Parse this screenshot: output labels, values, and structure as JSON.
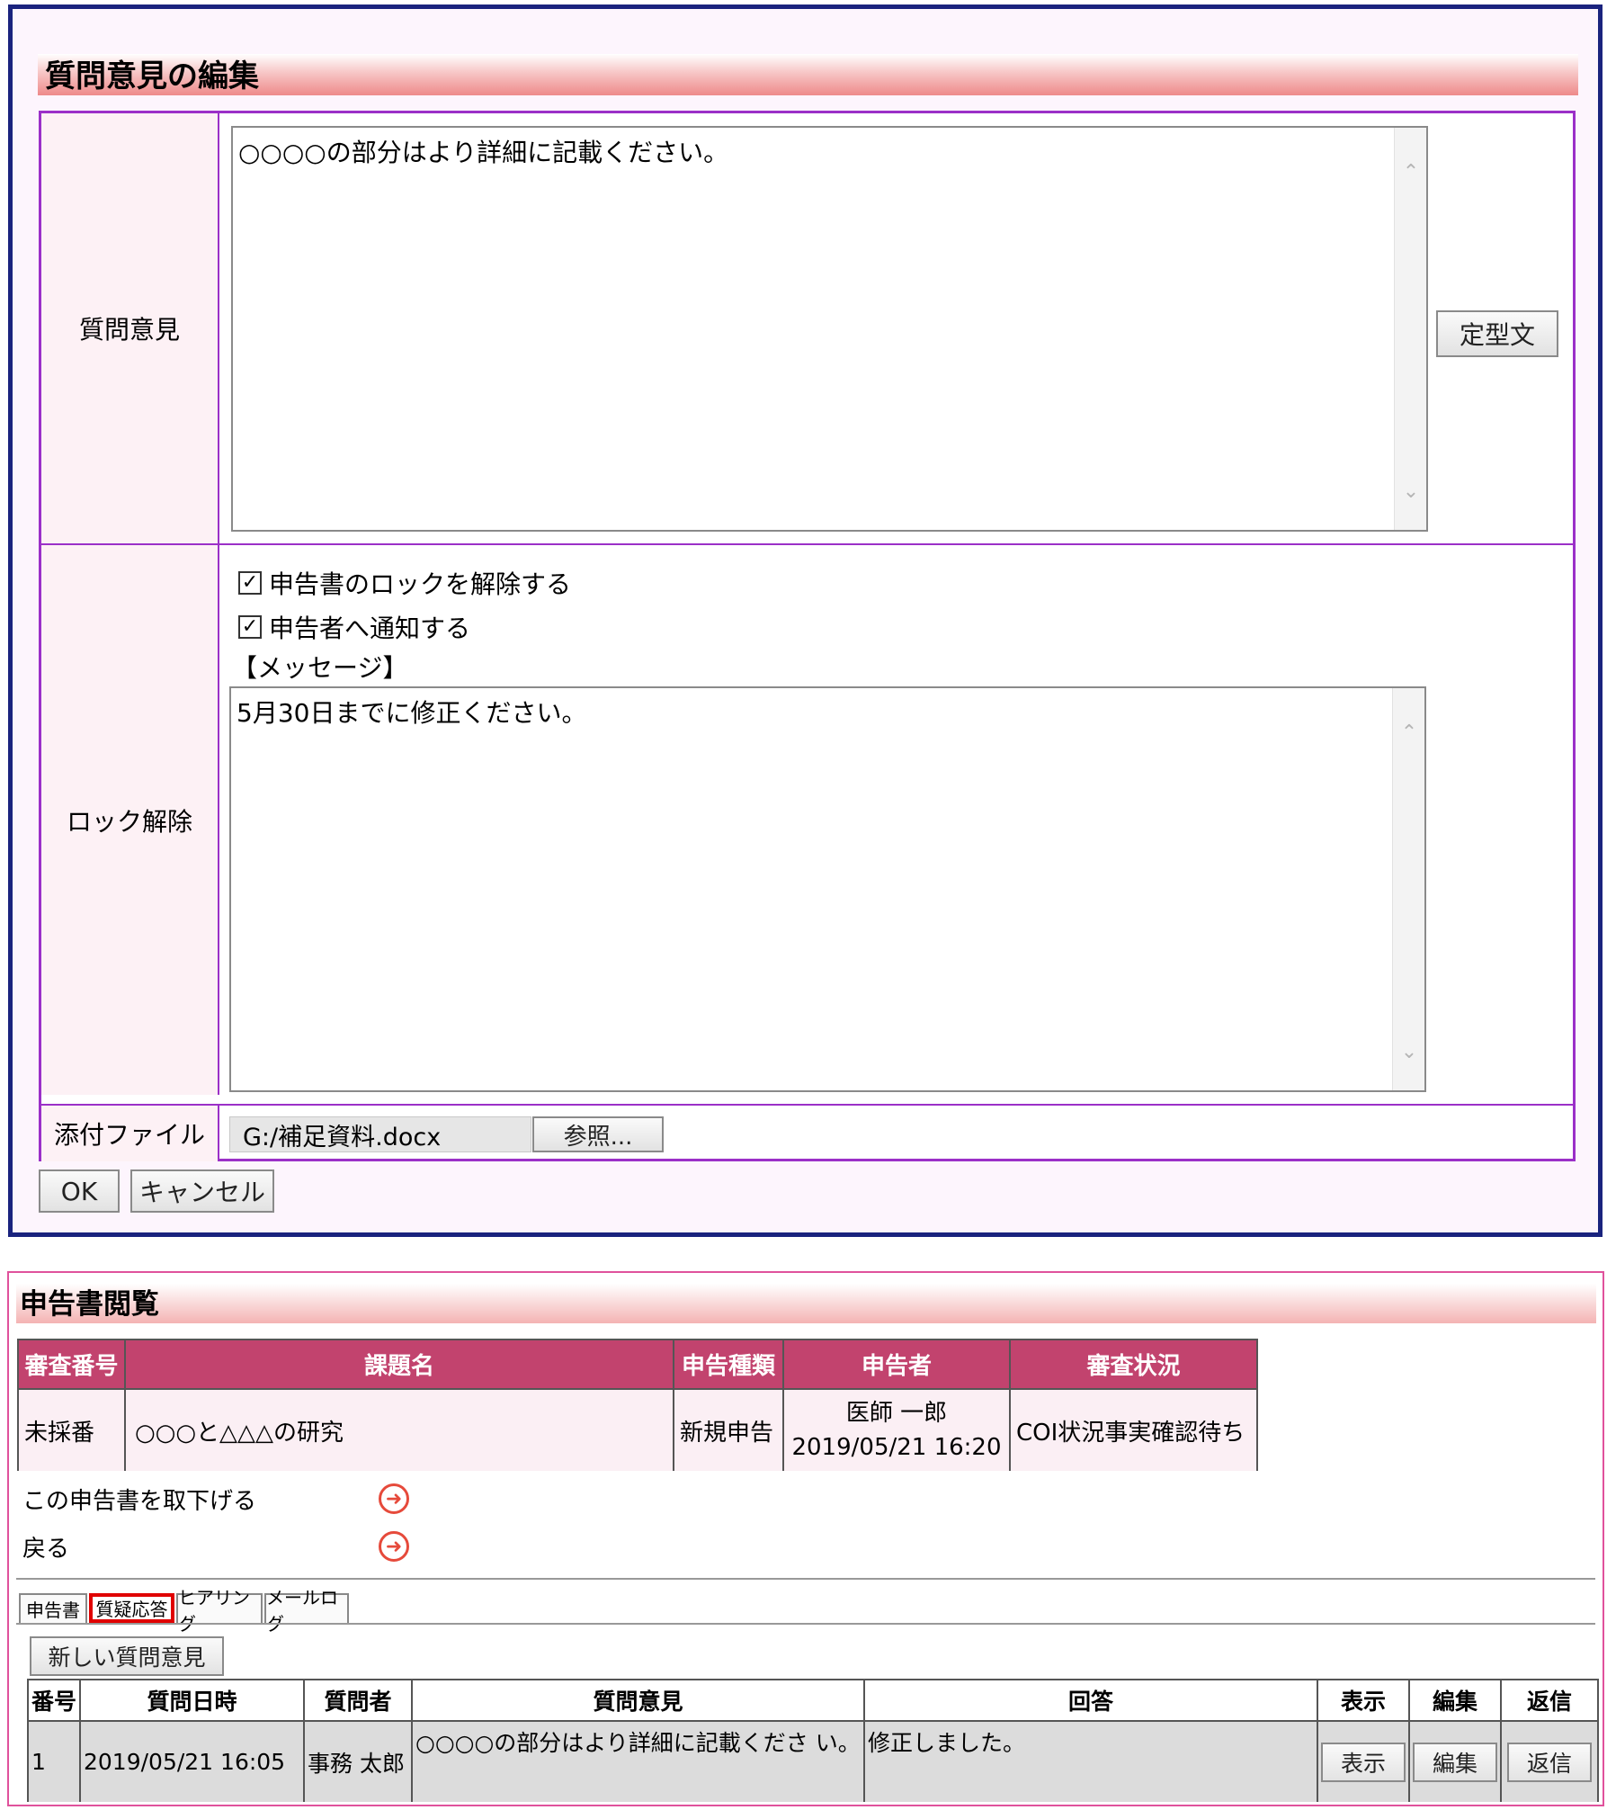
{
  "edit_dialog": {
    "title": "質問意見の編集",
    "question_label": "質問意見",
    "question_text": "○○○○の部分はより詳細に記載ください。",
    "template_button": "定型文",
    "unlock_label": "ロック解除",
    "unlock_checkbox": "申告書のロックを解除する",
    "notify_checkbox": "申告者へ通知する",
    "message_heading": "【メッセージ】",
    "message_text": "5月30日までに修正ください。",
    "attach_label": "添付ファイル",
    "attach_value": "G:/補足資料.docx",
    "browse_button": "参照...",
    "ok_button": "OK",
    "cancel_button": "キャンセル"
  },
  "view_dialog": {
    "title": "申告書閲覧",
    "summary_headers": [
      "審査番号",
      "課題名",
      "申告種類",
      "申告者",
      "審査状況"
    ],
    "summary_row": {
      "number": "未採番",
      "subject": "○○○と△△△の研究",
      "type": "新規申告",
      "applicant_name": "医師 一郎",
      "applicant_date": "2019/05/21 16:20",
      "status": "COI状況事実確認待ち"
    },
    "withdraw_link": "この申告書を取下げる",
    "back_link": "戻る",
    "tabs": [
      "申告書",
      "質疑応答",
      "ヒアリング",
      "メールログ"
    ],
    "new_question_button": "新しい質問意見",
    "list_headers": [
      "番号",
      "質問日時",
      "質問者",
      "質問意見",
      "回答",
      "表示",
      "編集",
      "返信"
    ],
    "list_row": {
      "number": "1",
      "datetime": "2019/05/21 16:05",
      "questioner": "事務 太郎",
      "question": "○○○○の部分はより詳細に記載くださ い。",
      "answer": "修正しました。",
      "view_button": "表示",
      "edit_button": "編集",
      "reply_button": "返信"
    }
  },
  "colors": {
    "dialog_border": "#1a237e",
    "table_border": "#9b30c8",
    "header_bg": "#c2436e",
    "highlight": "#e00000"
  }
}
